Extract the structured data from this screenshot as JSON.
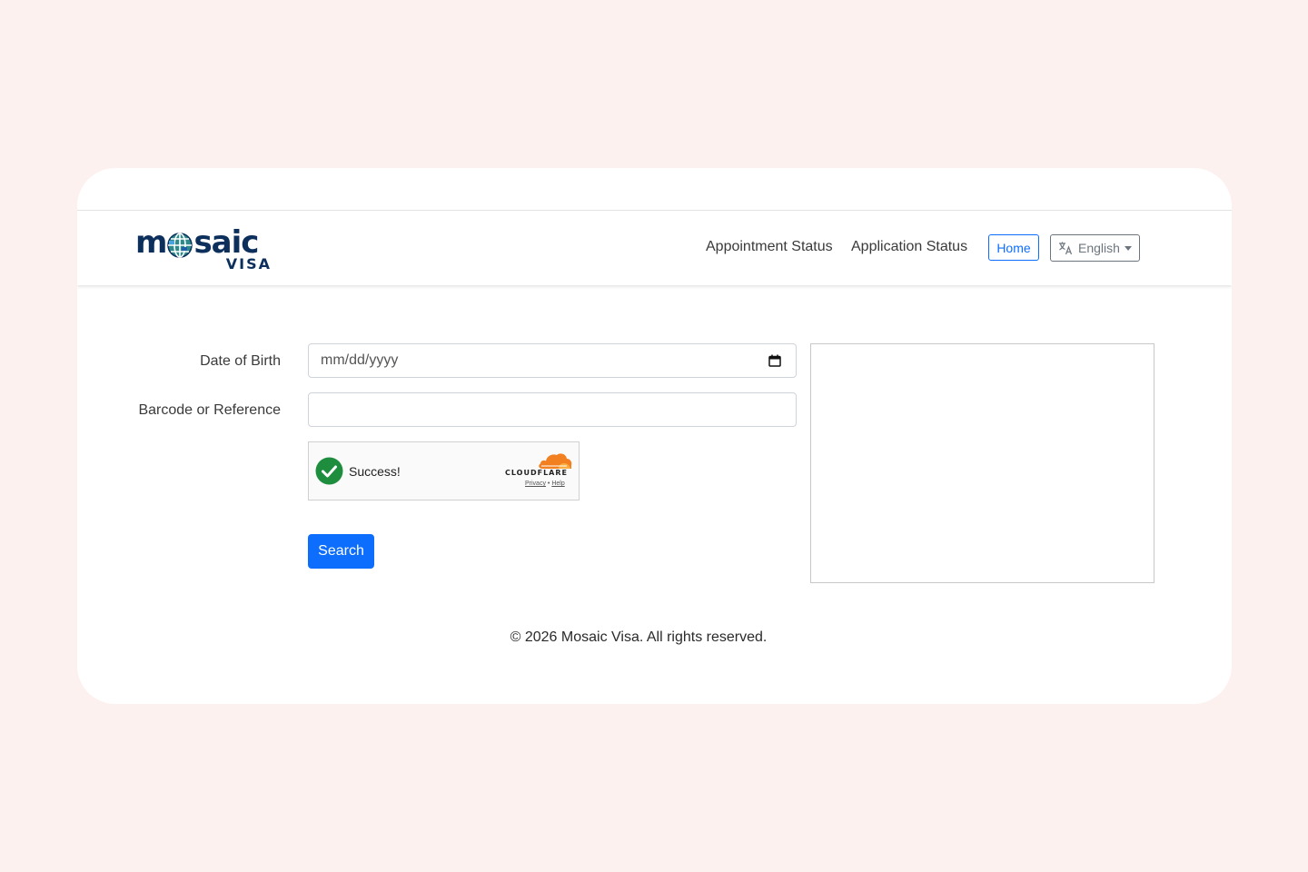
{
  "brand": {
    "logo_word_start": "m",
    "logo_word_end": "saic",
    "logo_sub": "VISA"
  },
  "nav": {
    "appointment_status": "Appointment Status",
    "application_status": "Application Status",
    "home": "Home",
    "language": "English"
  },
  "form": {
    "dob_label": "Date of Birth",
    "dob_placeholder": "mm/dd/yyyy",
    "barcode_label": "Barcode or Reference",
    "barcode_value": "",
    "captcha": {
      "status": "Success!",
      "provider": "CLOUDFLARE",
      "privacy_link": "Privacy",
      "separator": "•",
      "help_link": "Help"
    },
    "search_button": "Search"
  },
  "footer": {
    "copyright": "© 2026 Mosaic Visa. All rights reserved."
  },
  "colors": {
    "page_background": "#fdf1f0",
    "primary": "#0d6efd",
    "brand_navy": "#0c2f5c",
    "success_green": "#1e8e3e",
    "cloudflare_orange": "#f38020"
  },
  "icons": {
    "language": "translate-icon",
    "calendar": "calendar-icon",
    "captcha_check": "check-circle-icon",
    "cloudflare": "cloudflare-cloud-icon",
    "globe": "globe-icon"
  }
}
